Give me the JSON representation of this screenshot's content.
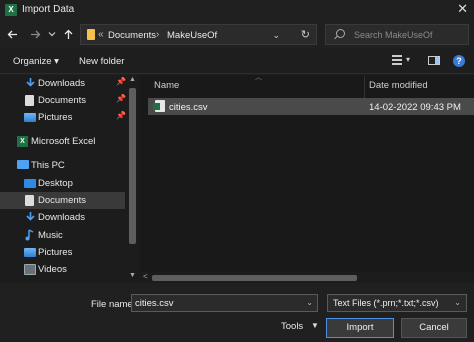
{
  "window": {
    "title": "Import Data",
    "app_icon": "X"
  },
  "address_bar": {
    "crumbs": [
      "Documents",
      "MakeUseOf"
    ],
    "separator": "›",
    "overflow": "«"
  },
  "search": {
    "placeholder": "Search MakeUseOf"
  },
  "toolbar": {
    "organize": "Organize ▾",
    "new_folder": "New folder"
  },
  "sidebar": {
    "quick_access": [
      {
        "label": "Downloads",
        "icon": "download-arrow-icon",
        "pinned": true
      },
      {
        "label": "Documents",
        "icon": "documents-icon",
        "pinned": true
      },
      {
        "label": "Pictures",
        "icon": "pictures-icon",
        "pinned": true
      }
    ],
    "excel": {
      "label": "Microsoft Excel",
      "icon": "excel-icon"
    },
    "this_pc": {
      "label": "This PC",
      "icon": "computer-icon"
    },
    "pc_items": [
      {
        "label": "Desktop",
        "icon": "desktop-icon"
      },
      {
        "label": "Documents",
        "icon": "documents-icon",
        "selected": true
      },
      {
        "label": "Downloads",
        "icon": "download-arrow-icon"
      },
      {
        "label": "Music",
        "icon": "music-note-icon"
      },
      {
        "label": "Pictures",
        "icon": "pictures-icon"
      },
      {
        "label": "Videos",
        "icon": "videos-icon"
      }
    ]
  },
  "file_list": {
    "columns": {
      "name": "Name",
      "date": "Date modified"
    },
    "rows": [
      {
        "name": "cities.csv",
        "date": "14-02-2022 09:43 PM",
        "selected": true
      }
    ]
  },
  "bottom": {
    "file_name_label": "File name:",
    "file_name_value": "cities.csv",
    "file_type": "Text Files (*.prn;*.txt;*.csv)",
    "tools": "Tools",
    "import": "Import",
    "cancel": "Cancel"
  },
  "colors": {
    "background": "#202020",
    "selection": "#4a4a4a",
    "accent": "#4a8fe0",
    "excel_green": "#1e7145",
    "folder_yellow": "#f3c34c"
  }
}
